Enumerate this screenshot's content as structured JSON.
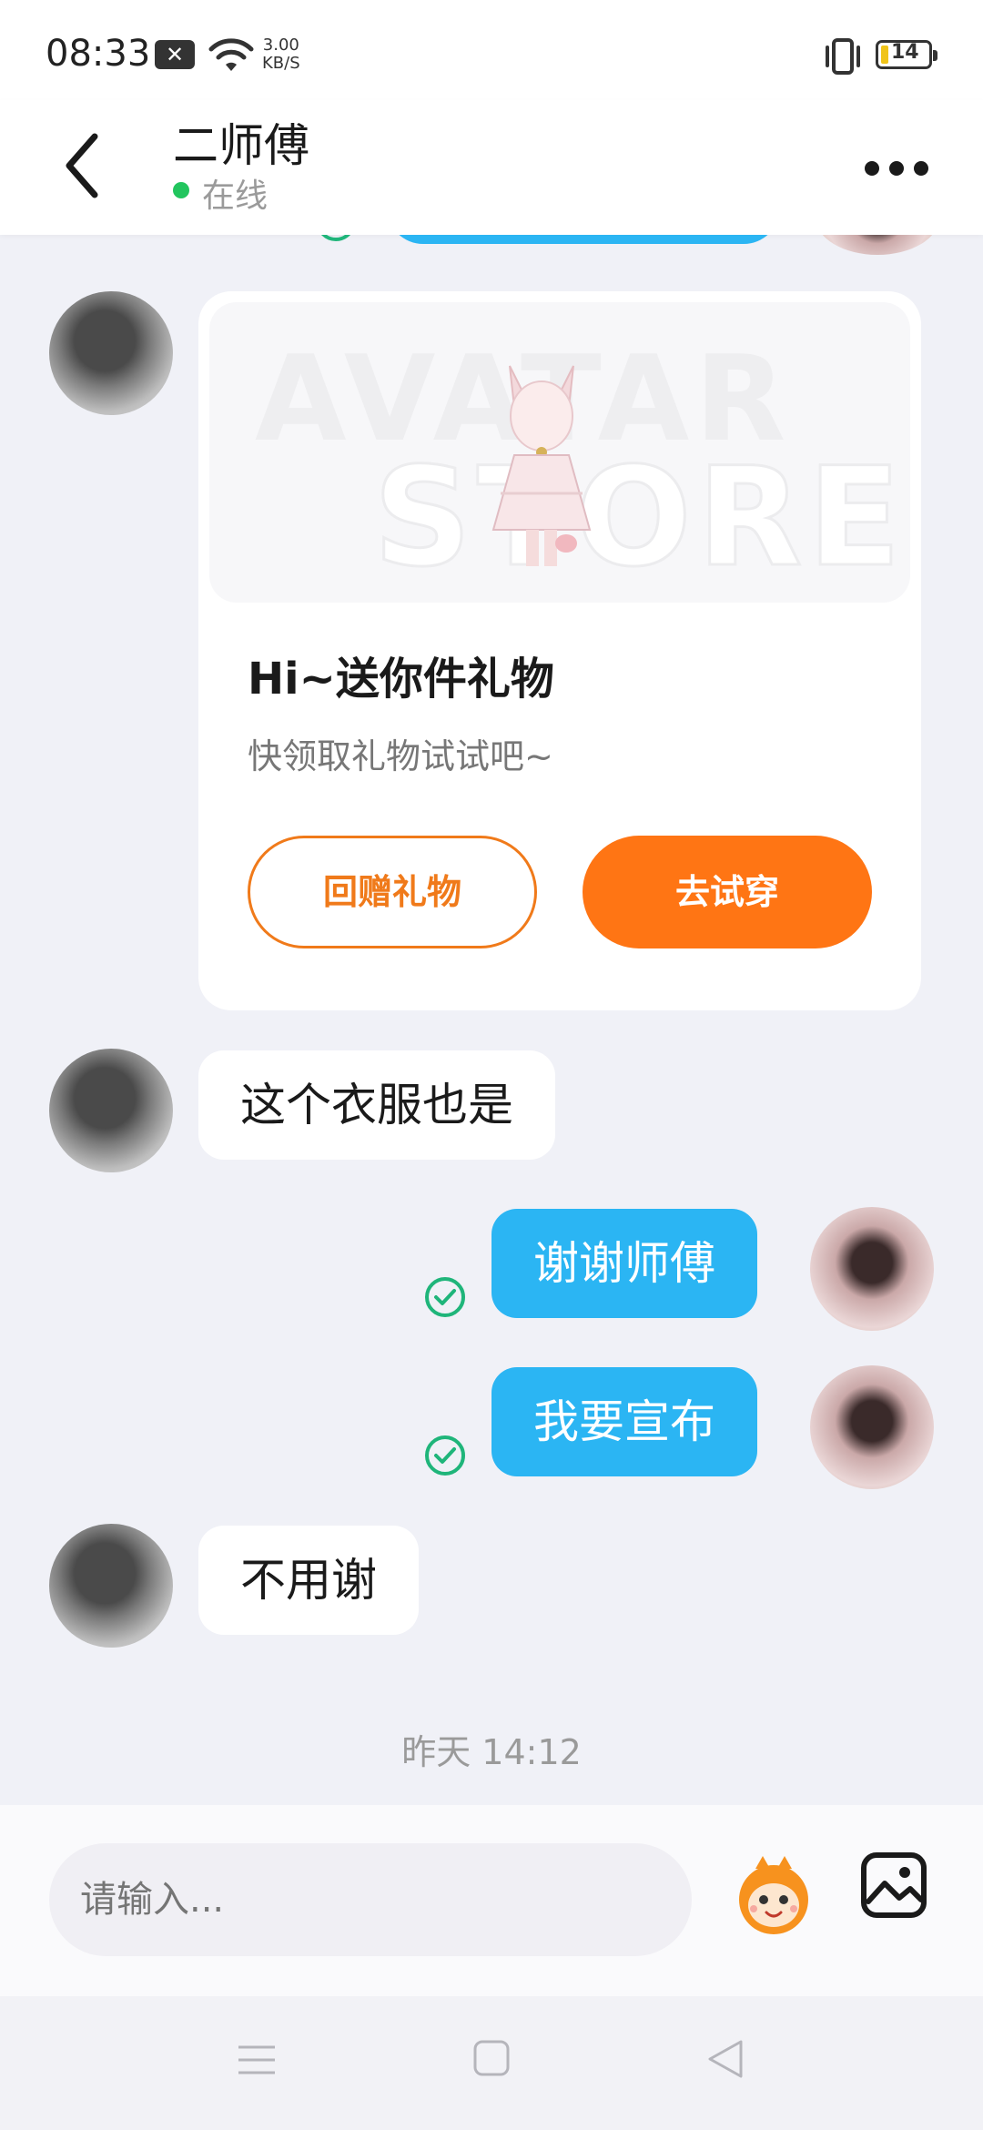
{
  "status_bar": {
    "time": "08:33",
    "network_speed_value": "3.00",
    "network_speed_unit": "KB/S",
    "battery_level": "14",
    "notification_icon": "close-notification-icon",
    "wifi_icon": "wifi-icon",
    "vibrate_icon": "vibrate-icon"
  },
  "header": {
    "title": "二师傅",
    "status": "在线",
    "status_color": "#22c55e"
  },
  "messages": [
    {
      "id": 1,
      "side": "incoming",
      "text": "这个衣服也是"
    },
    {
      "id": 2,
      "side": "outgoing",
      "text": "谢谢师傅",
      "read": true
    },
    {
      "id": 3,
      "side": "outgoing",
      "text": "我要宣布",
      "read": true
    },
    {
      "id": 4,
      "side": "incoming",
      "text": "不用谢"
    }
  ],
  "gift_card": {
    "watermark_top": "AVATAR",
    "watermark_bottom": "STORE",
    "title": "Hi~送你件礼物",
    "subtitle": "快领取礼物试试吧~",
    "return_gift_label": "回赠礼物",
    "try_on_label": "去试穿",
    "accent_color": "#ff7514"
  },
  "timestamp": "昨天 14:12",
  "input": {
    "placeholder": "请输入..."
  },
  "colors": {
    "bubble_out": "#2bb5f3",
    "bubble_in": "#ffffff",
    "background": "#f0f1f7",
    "check": "#1fb57a"
  }
}
